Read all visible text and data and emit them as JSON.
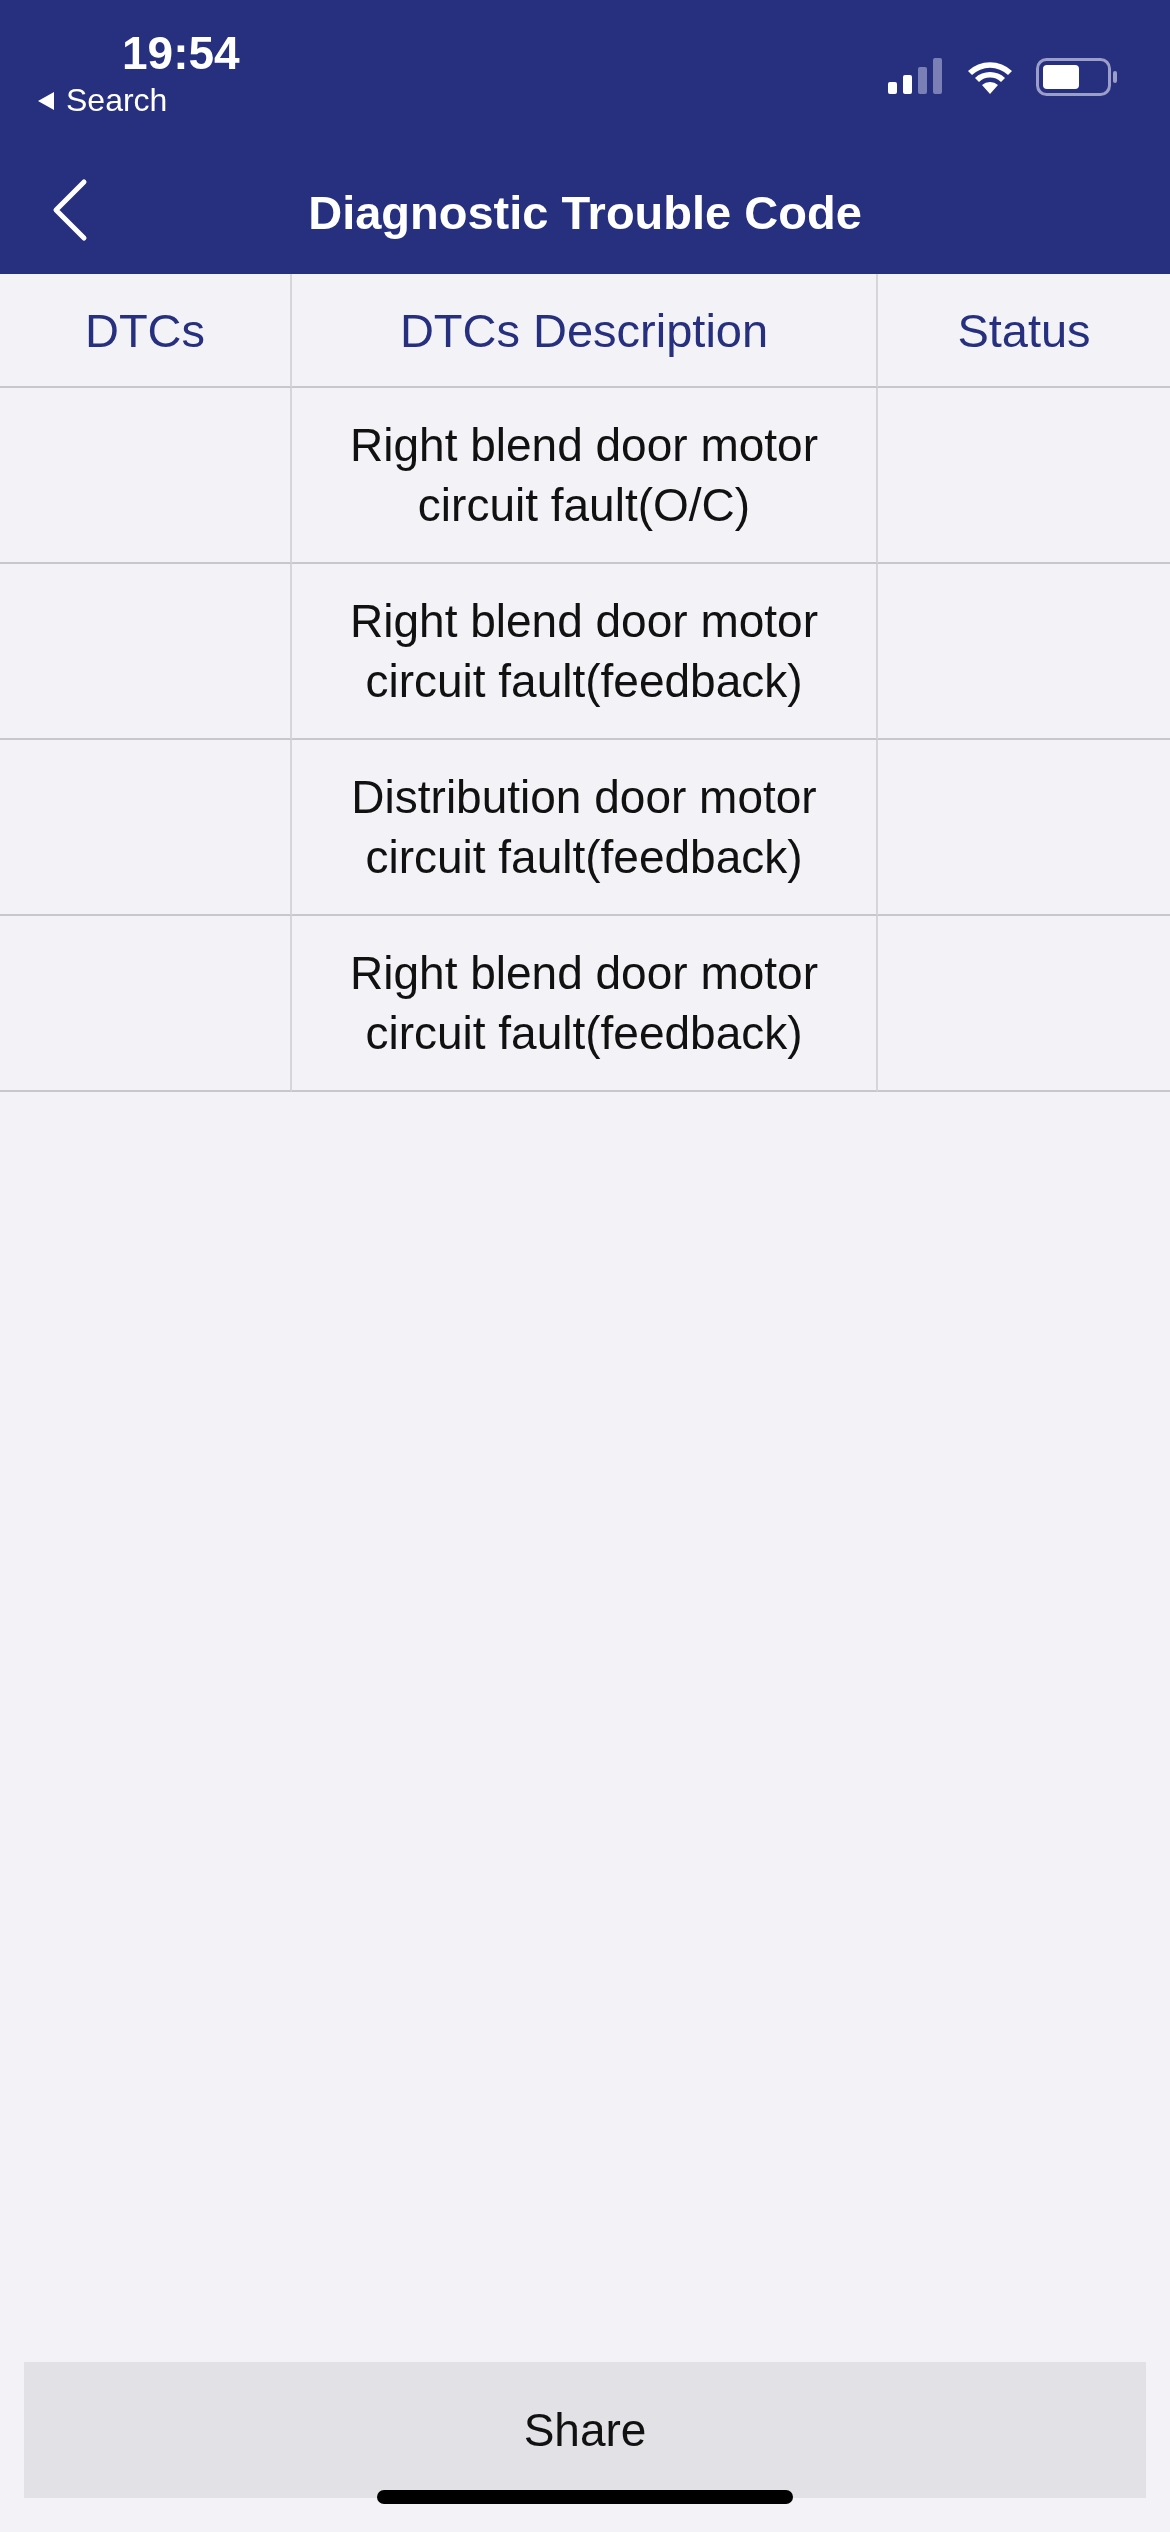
{
  "status_bar": {
    "time": "19:54",
    "back_link": "Search"
  },
  "nav": {
    "title": "Diagnostic Trouble Code"
  },
  "table": {
    "columns": [
      "DTCs",
      "DTCs Description",
      "Status"
    ],
    "rows": [
      {
        "description": "Right blend door motor circuit fault(O/C)"
      },
      {
        "description": "Right blend door motor circuit fault(feedback)"
      },
      {
        "description": "Distribution door motor circuit fault(feedback)"
      },
      {
        "description": "Right blend door motor circuit fault(feedback)"
      }
    ]
  },
  "share_button": "Share"
}
